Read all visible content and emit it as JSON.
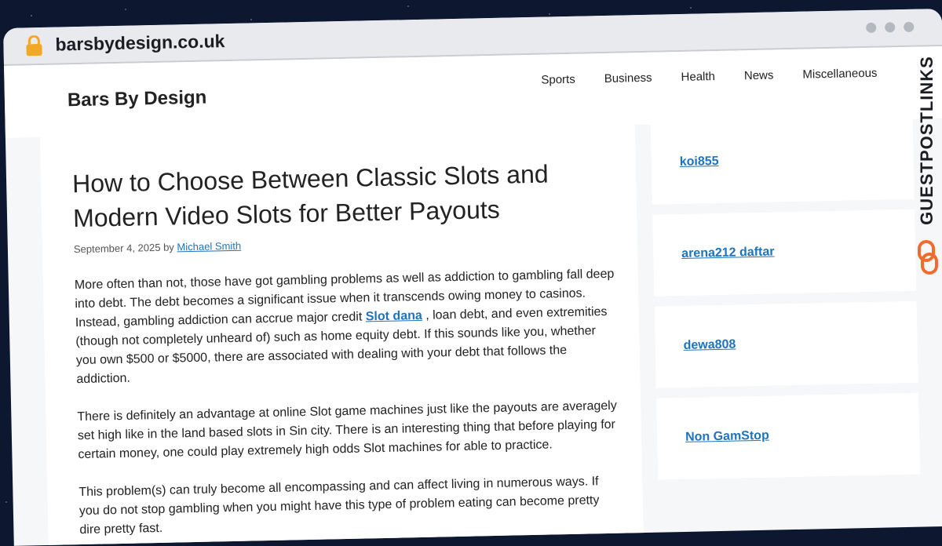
{
  "browser": {
    "url": "barsbydesign.co.uk"
  },
  "site": {
    "title": "Bars By Design",
    "nav": [
      "Sports",
      "Business",
      "Health",
      "News",
      "Miscellaneous"
    ]
  },
  "post": {
    "title": "How to Choose Between Classic Slots and Modern Video Slots for Better Payouts",
    "date": "September 4, 2025",
    "by": "by",
    "author": "Michael Smith",
    "p1_before": "More often than not, those have got gambling problems as well as addiction to gambling fall deep into debt. The debt becomes a significant issue when it transcends owing money to casinos. Instead, gambling addiction can accrue major credit",
    "p1_link": "Slot dana",
    "p1_after": ", loan debt, and even extremities (though not completely unheard of) such as home equity debt. If this sounds like you, whether you own $500 or $5000, there are associated with dealing with your debt that follows the addiction.",
    "p2": "There is definitely an advantage at online Slot game machines just like the payouts are averagely set high like in the land based slots in Sin city. There is an interesting thing that before playing for certain money, one could play extremely high odds Slot machines for able to practice.",
    "p3": "This problem(s) can truly become all encompassing and can affect living in numerous ways. If you do not stop gambling when you might have this type of problem eating can become pretty dire pretty fast."
  },
  "sidebar": {
    "links": [
      "koi855",
      "arena212 daftar",
      "dewa808",
      "Non GamStop"
    ]
  },
  "watermark": {
    "text": "GUESTPOSTLINKS"
  },
  "colors": {
    "link": "#1e73be",
    "lock": "#f2a825",
    "brand_orange": "#f26a2e"
  }
}
